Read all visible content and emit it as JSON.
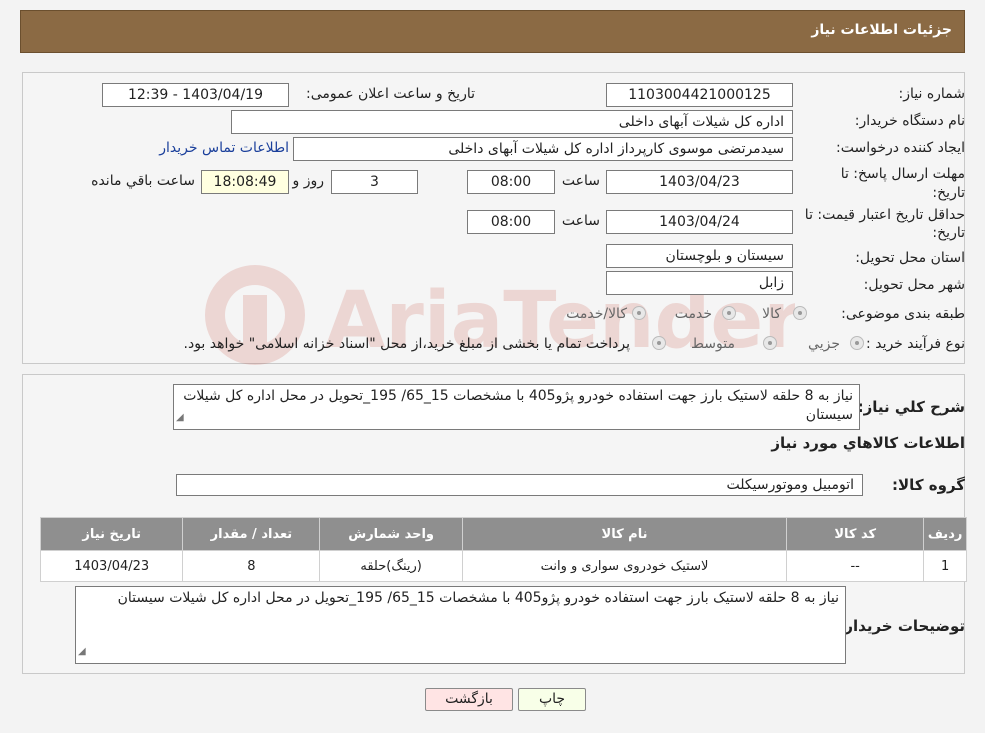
{
  "header": {
    "title": "جزئیات اطلاعات نیاز"
  },
  "form": {
    "need_number_label": "شماره نیاز:",
    "need_number": "1103004421000125",
    "announce_label": "تاریخ و ساعت اعلان عمومی:",
    "announce_value": "1403/04/19 - 12:39",
    "buyer_org_label": "نام دستگاه خریدار:",
    "buyer_org": "اداره کل شیلات آبهای داخلی",
    "creator_label": "ایجاد کننده درخواست:",
    "creator": "سیدمرتضی موسوی کارپرداز اداره کل شیلات آبهای داخلی",
    "contact_link": "اطلاعات تماس خریدار",
    "deadline_label_1": "مهلت ارسال پاسخ: تا",
    "deadline_label_2": "تاریخ:",
    "deadline_date": "1403/04/23",
    "time_label": "ساعت",
    "deadline_time": "08:00",
    "days_value": "3",
    "days_label": "روز و",
    "remaining_time": "18:08:49",
    "remaining_label": "ساعت باقي مانده",
    "price_valid_label_1": "حداقل تاریخ اعتبار قیمت: تا",
    "price_valid_label_2": "تاریخ:",
    "price_valid_date": "1403/04/24",
    "price_valid_time": "08:00",
    "province_label": "استان محل تحویل:",
    "province": "سیستان و بلوچستان",
    "city_label": "شهر محل تحویل:",
    "city": "زابل",
    "category_label": "طبقه بندی موضوعی:",
    "category_options": [
      "کالا",
      "خدمت",
      "کالا/خدمت"
    ],
    "process_label": "نوع فرآیند خرید :",
    "process_options": [
      "جزیي",
      "متوسط"
    ],
    "payment_note": "پرداخت تمام یا بخشی از مبلغ خرید،از محل \"اسناد خزانه اسلامی\" خواهد بود."
  },
  "need": {
    "summary_label": "شرح کلي نياز:",
    "summary": "نیاز به 8 حلقه لاستیک بارز جهت استفاده خودرو پژو405  با مشخصات 15_65/ 195_تحویل در محل اداره کل شیلات سیستان",
    "items_title": "اطلاعات کالاهاي مورد نياز",
    "group_label": "گروه کالا:",
    "group": "اتومبیل وموتورسیکلت"
  },
  "table": {
    "headers": [
      "رديف",
      "کد کالا",
      "نام کالا",
      "واحد شمارش",
      "تعداد / مقدار",
      "تاریخ نیاز"
    ],
    "rows": [
      [
        "1",
        "--",
        "لاستیک خودروی سواری و وانت",
        "(رينگ)حلقه",
        "8",
        "1403/04/23"
      ]
    ]
  },
  "buyer_notes": {
    "label": "توضیحات خریدار:",
    "text": "نیاز به 8 حلقه لاستیک بارز جهت استفاده خودرو پژو405  با مشخصات 15_65/ 195_تحویل در محل اداره کل شیلات سیستان"
  },
  "buttons": {
    "print": "چاپ",
    "back": "بازگشت"
  },
  "watermark_text": "AriaTender.neT"
}
